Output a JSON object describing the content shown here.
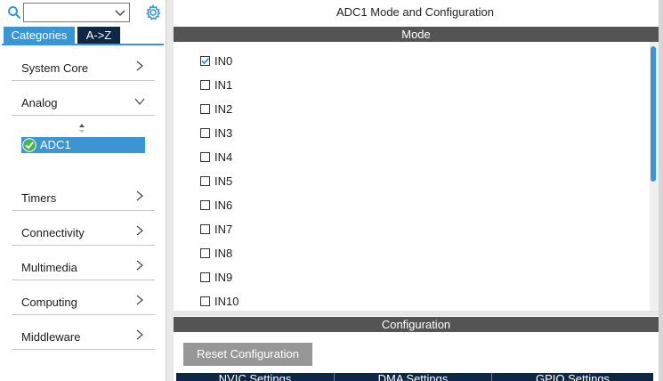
{
  "sidebar": {
    "tabs": [
      "Categories",
      "A->Z"
    ],
    "categories": [
      {
        "label": "System Core",
        "expanded": false
      },
      {
        "label": "Analog",
        "expanded": true
      },
      {
        "label": "Timers",
        "expanded": false
      },
      {
        "label": "Connectivity",
        "expanded": false
      },
      {
        "label": "Multimedia",
        "expanded": false
      },
      {
        "label": "Computing",
        "expanded": false
      },
      {
        "label": "Middleware",
        "expanded": false
      }
    ],
    "analog_items": [
      {
        "label": "ADC1",
        "status": "ok",
        "selected": true
      }
    ]
  },
  "main": {
    "title": "ADC1 Mode and Configuration",
    "mode_header": "Mode",
    "channels": [
      {
        "label": "IN0",
        "checked": true
      },
      {
        "label": "IN1",
        "checked": false
      },
      {
        "label": "IN2",
        "checked": false
      },
      {
        "label": "IN3",
        "checked": false
      },
      {
        "label": "IN4",
        "checked": false
      },
      {
        "label": "IN5",
        "checked": false
      },
      {
        "label": "IN6",
        "checked": false
      },
      {
        "label": "IN7",
        "checked": false
      },
      {
        "label": "IN8",
        "checked": false
      },
      {
        "label": "IN9",
        "checked": false
      },
      {
        "label": "IN10",
        "checked": false
      }
    ],
    "config_header": "Configuration",
    "reset_label": "Reset Configuration",
    "settings_tabs": [
      "NVIC Settings",
      "DMA Settings",
      "GPIO Settings"
    ]
  },
  "colors": {
    "accent": "#3b95d2",
    "dark_navy": "#0e2744",
    "section_bar": "#545454",
    "button_gray": "#979797"
  }
}
